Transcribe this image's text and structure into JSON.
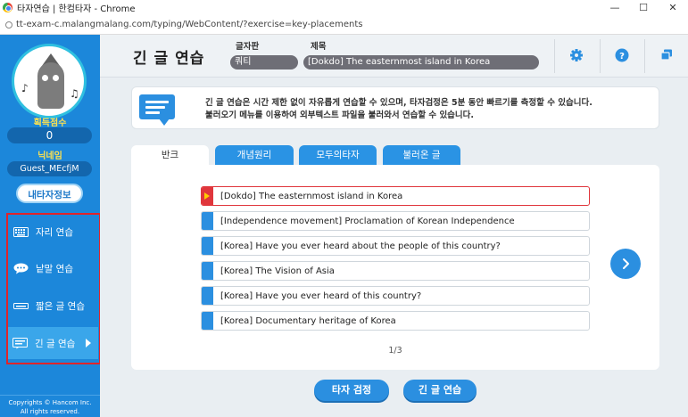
{
  "window": {
    "title": "타자연습 | 한컴타자 - Chrome",
    "url": "tt-exam-c.malangmalang.com/typing/WebContent/?exercise=key-placements"
  },
  "sidebar": {
    "score_label": "획득점수",
    "score_value": "0",
    "nickname_label": "닉네임",
    "nickname_value": "Guest_MEcfjM",
    "my_info_button": "내타자정보",
    "menu": [
      {
        "label": "자리 연습",
        "icon": "keyboard-icon"
      },
      {
        "label": "낱말 연습",
        "icon": "speech-bubble-icon"
      },
      {
        "label": "짧은 글 연습",
        "icon": "short-text-icon"
      },
      {
        "label": "긴 글 연습",
        "icon": "long-text-icon",
        "active": true
      }
    ],
    "copyright_line1": "Copyrights © Hancom Inc.",
    "copyright_line2": "All rights reserved."
  },
  "header": {
    "title": "긴 글 연습",
    "layout_label": "글자판",
    "layout_value": "쿼티",
    "subject_label": "제목",
    "subject_value": "[Dokdo] The easternmost island in Korea",
    "icons": [
      "settings-icon",
      "help-icon",
      "window-icon"
    ]
  },
  "notice": {
    "line1": "긴 글 연습은 시간 제한 없이 자유롭게 연습할 수 있으며, 타자검정은 5분 동안 빠르기를 측정할 수 있습니다.",
    "line2": "불러오기 메뉴를 이용하여 외부텍스트 파일을 불러와서 연습할 수 있습니다."
  },
  "tabs": [
    {
      "label": "반크",
      "active": true
    },
    {
      "label": "개념원리",
      "active": false
    },
    {
      "label": "모두의타자",
      "active": false
    },
    {
      "label": "불러온 글",
      "active": false
    }
  ],
  "list": [
    {
      "label": "[Dokdo] The easternmost island in Korea",
      "selected": true
    },
    {
      "label": "[Independence movement] Proclamation of Korean Independence",
      "selected": false
    },
    {
      "label": "[Korea] Have you ever heard about the people of this country?",
      "selected": false
    },
    {
      "label": "[Korea] The Vision of Asia",
      "selected": false
    },
    {
      "label": "[Korea] Have you ever heard of this country?",
      "selected": false
    },
    {
      "label": "[Korea] Documentary heritage of Korea",
      "selected": false
    }
  ],
  "pager": "1/3",
  "actions": {
    "typing_test": "타자 검정",
    "long_practice": "긴 글 연습"
  },
  "colors": {
    "sidebar": "#1c87da",
    "accent": "#2b8fe0",
    "selected": "#e0363c",
    "highlight_yellow": "#ffe14d"
  }
}
